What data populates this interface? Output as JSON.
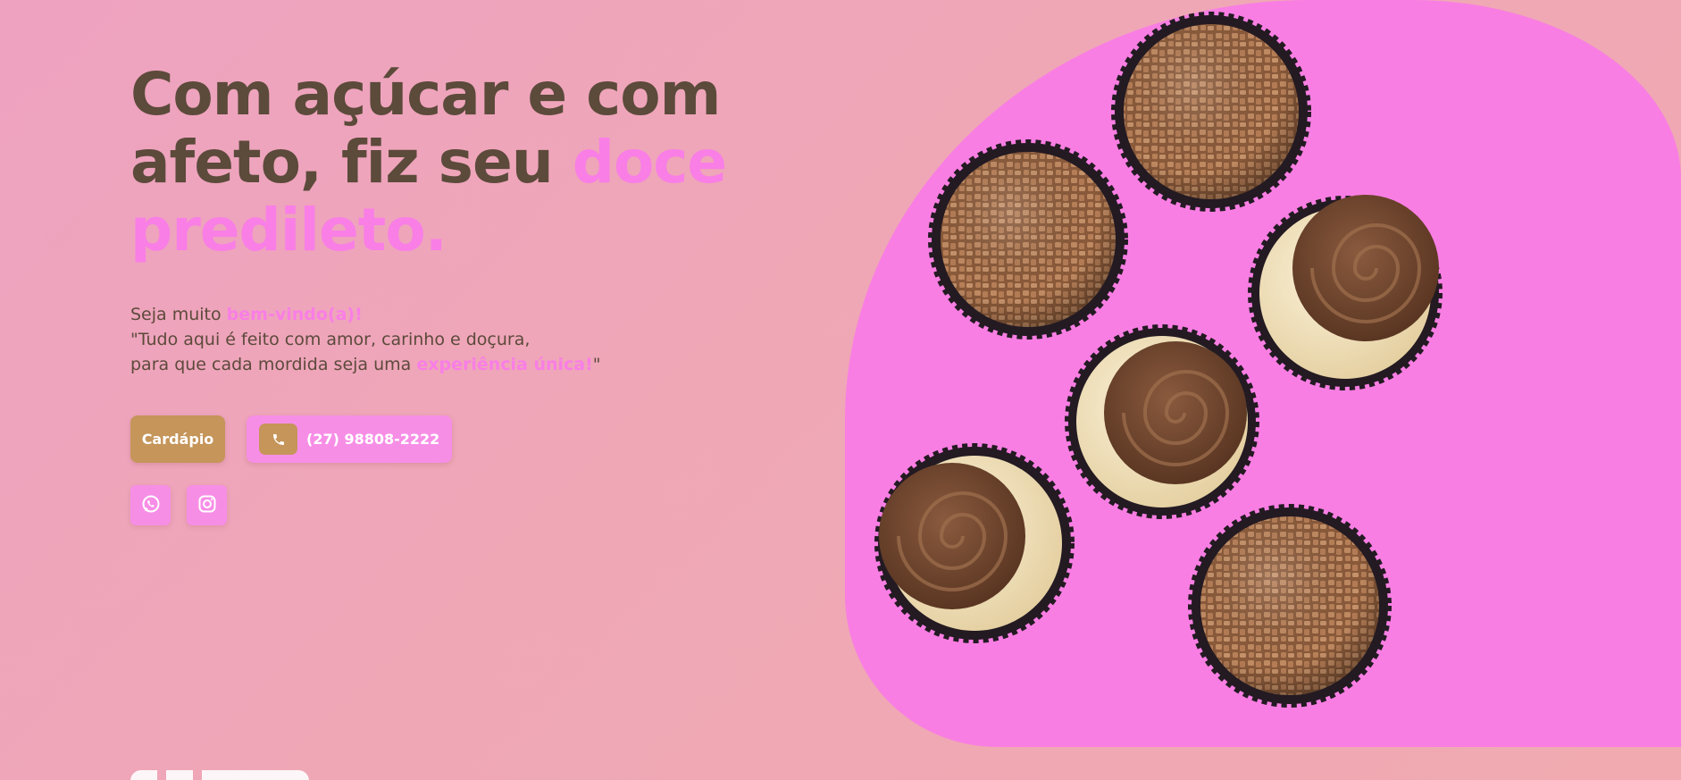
{
  "hero": {
    "headline_line1": "Com açúcar e com",
    "headline_line2_main": "afeto, fiz seu ",
    "headline_line2_accent": "doce",
    "headline_line3_accent": "predileto.",
    "welcome_prefix": "Seja muito ",
    "welcome_highlight": "bem-vindo(a)!",
    "quote_line1": "\"Tudo aqui é feito com amor, carinho e doçura,",
    "quote_line2_prefix": "para que cada mordida seja uma ",
    "quote_line2_highlight": "experiência única!",
    "quote_line2_suffix": "\""
  },
  "actions": {
    "menu_label": "Cardápio",
    "phone_label": "(27) 98808-2222"
  },
  "social": {
    "whatsapp_icon": "whatsapp-icon",
    "instagram_icon": "instagram-icon"
  },
  "colors": {
    "accent_pink": "#f97ee6",
    "brown_text": "#5c4a3b",
    "gold_button": "#c5955a",
    "blob_pink": "#f97ee3"
  }
}
